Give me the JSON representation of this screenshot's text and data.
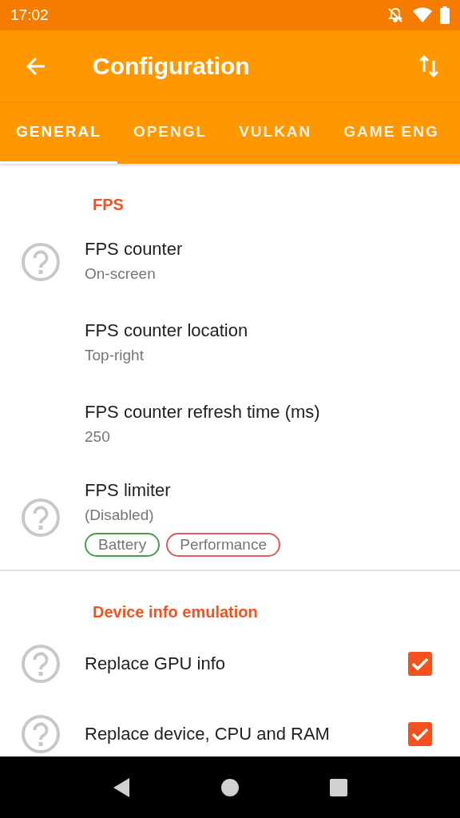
{
  "status_bar": {
    "time": "17:02"
  },
  "app_bar": {
    "title": "Configuration"
  },
  "tabs": [
    {
      "label": "GENERAL",
      "selected": true
    },
    {
      "label": "OPENGL",
      "selected": false
    },
    {
      "label": "VULKAN",
      "selected": false
    },
    {
      "label": "GAME ENG",
      "selected": false
    }
  ],
  "sections": [
    {
      "header": "FPS",
      "items": [
        {
          "title": "FPS counter",
          "summary": "On-screen",
          "help": true
        },
        {
          "title": "FPS counter location",
          "summary": "Top-right",
          "help": false
        },
        {
          "title": "FPS counter refresh time (ms)",
          "summary": "250",
          "help": false
        },
        {
          "title": "FPS limiter",
          "summary": "(Disabled)",
          "help": true,
          "tags": [
            {
              "label": "Battery",
              "color": "#43a047"
            },
            {
              "label": "Performance",
              "color": "#e05a5a"
            }
          ]
        }
      ]
    },
    {
      "header": "Device info emulation",
      "items": [
        {
          "title": "Replace GPU info",
          "help": true,
          "checked": true
        },
        {
          "title": "Replace device, CPU and RAM",
          "help": true,
          "checked": true
        }
      ]
    }
  ]
}
